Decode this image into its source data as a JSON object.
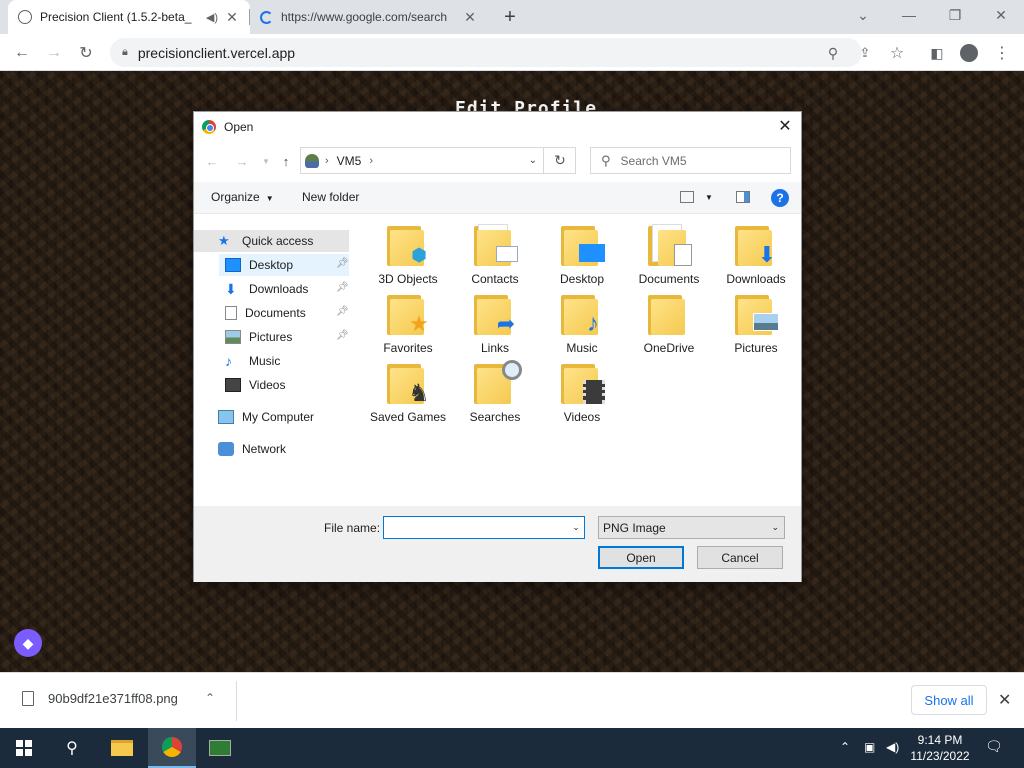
{
  "browser": {
    "tabs": [
      {
        "title": "Precision Client (1.5.2-beta_"
      },
      {
        "title": "https://www.google.com/search"
      }
    ],
    "url": "precisionclient.vercel.app"
  },
  "page": {
    "heading": "Edit Profile"
  },
  "dialog": {
    "title": "Open",
    "path": "VM5",
    "search_placeholder": "Search VM5",
    "organize_label": "Organize",
    "new_folder_label": "New folder",
    "help_label": "?",
    "nav": {
      "quick_access": "Quick access",
      "items": [
        {
          "label": "Desktop",
          "pinned": true
        },
        {
          "label": "Downloads",
          "pinned": true
        },
        {
          "label": "Documents",
          "pinned": true
        },
        {
          "label": "Pictures",
          "pinned": true
        },
        {
          "label": "Music",
          "pinned": false
        },
        {
          "label": "Videos",
          "pinned": false
        }
      ],
      "my_computer": "My Computer",
      "network": "Network"
    },
    "folders": [
      {
        "name": "3D Objects",
        "icon": "cube-icon"
      },
      {
        "name": "Contacts",
        "icon": "contact-card-icon"
      },
      {
        "name": "Desktop",
        "icon": "monitor-icon"
      },
      {
        "name": "Documents",
        "icon": "document-icon"
      },
      {
        "name": "Downloads",
        "icon": "download-arrow-icon"
      },
      {
        "name": "Favorites",
        "icon": "star-icon"
      },
      {
        "name": "Links",
        "icon": "link-arrow-icon"
      },
      {
        "name": "Music",
        "icon": "music-note-icon"
      },
      {
        "name": "OneDrive",
        "icon": "folder-icon"
      },
      {
        "name": "Pictures",
        "icon": "picture-icon"
      },
      {
        "name": "Saved Games",
        "icon": "chess-piece-icon"
      },
      {
        "name": "Searches",
        "icon": "magnifier-icon"
      },
      {
        "name": "Videos",
        "icon": "film-icon"
      }
    ],
    "file_name_label": "File name:",
    "file_name_value": "",
    "file_type": "PNG Image",
    "open_label": "Open",
    "cancel_label": "Cancel"
  },
  "downloads": {
    "file": "90b9df21e371ff08.png",
    "show_all": "Show all"
  },
  "taskbar": {
    "time": "9:14 PM",
    "date": "11/23/2022"
  },
  "colors": {
    "accent": "#0078d7",
    "folder_yellow": "#f4c94e",
    "chrome_link": "#1a73e8",
    "taskbar": "#1c2b3b"
  }
}
